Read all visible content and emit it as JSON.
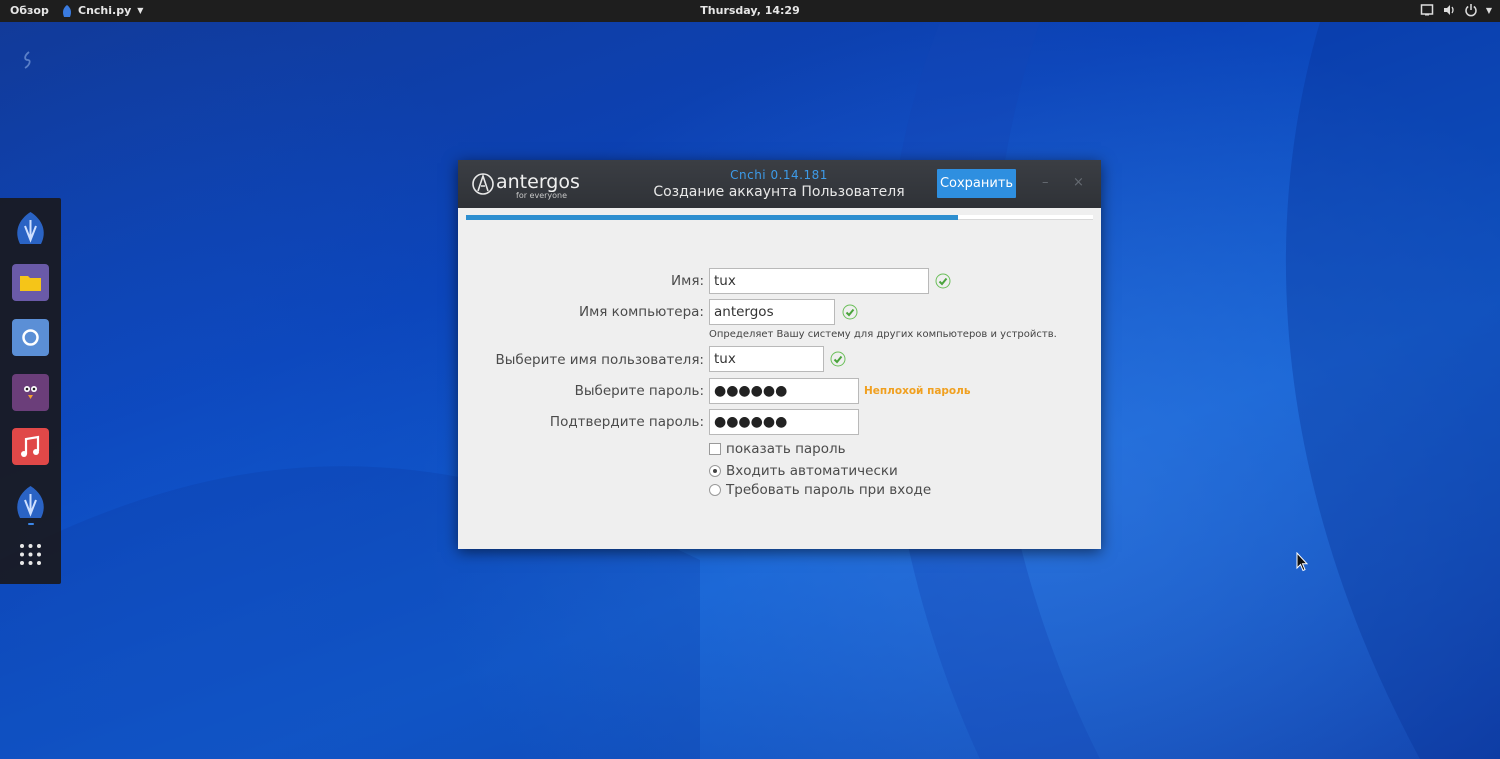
{
  "topbar": {
    "activities": "Обзор",
    "app_name": "Cnchi.py",
    "clock": "Thursday, 14:29",
    "tray_icons": [
      "display-icon",
      "volume-icon",
      "power-icon"
    ]
  },
  "dock": {
    "items": [
      "antergos-installer-icon",
      "files-icon",
      "chromium-icon",
      "pidgin-icon",
      "music-icon",
      "antergos-icon",
      "app-grid-icon"
    ]
  },
  "window": {
    "logo_text": "antergos",
    "logo_tagline": "for everyone",
    "subtitle": "Cnchi  0.14.181",
    "title": "Создание аккаунта Пользователя",
    "save_label": "Сохранить",
    "minimize_glyph": "–",
    "close_glyph": "×",
    "progress": 0.785
  },
  "form": {
    "name_label": "Имя:",
    "name_value": "tux",
    "hostname_label": "Имя компьютера:",
    "hostname_value": "antergos",
    "hostname_hint": "Определяет Вашу систему для других компьютеров и устройств.",
    "username_label": "Выберите имя пользователя:",
    "username_value": "tux",
    "password_label": "Выберите пароль:",
    "password_value": "●●●●●●",
    "password_strength": "Неплохой пароль",
    "confirm_label": "Подтвердите пароль:",
    "confirm_value": "●●●●●●",
    "show_password_label": "показать пароль",
    "autologin_label": "Входить автоматически",
    "require_password_label": "Требовать пароль при входе"
  },
  "colors": {
    "accent": "#2e8fe0",
    "check_green": "#4aa33c",
    "strength_orange": "#f0a020"
  }
}
